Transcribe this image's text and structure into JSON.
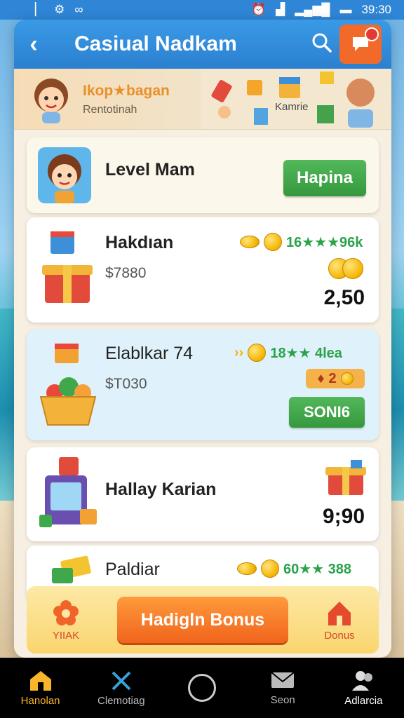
{
  "status_bar": {
    "time": "39:30"
  },
  "topbar": {
    "title": "Casiual Nadkam"
  },
  "banner": {
    "title": "Ikop★bagan",
    "subtitle": "Rentotinah",
    "right_label": "Kamrie"
  },
  "cards": [
    {
      "title": "Level Mam",
      "button": "Hapina"
    },
    {
      "title": "Hakdıan",
      "sub": "$7880",
      "stats": "16★★★96k",
      "value": "2,50"
    },
    {
      "title": "Elablkar 74",
      "sub": "$T030",
      "stats": "18★★ 4lea",
      "mini": "2",
      "button": "SONI6"
    },
    {
      "title": "Hallay Karian",
      "value": "9;90"
    },
    {
      "title": "Paldiar",
      "stats": "60★★ 388"
    }
  ],
  "bonus": {
    "left_label": "YIIAK",
    "button": "Hadigln Bonus",
    "right_label": "Donus"
  },
  "bottom_nav": [
    {
      "label": "Hanolan",
      "icon": "home-icon",
      "active": true
    },
    {
      "label": "Clemotiag",
      "icon": "tools-icon",
      "active": false
    },
    {
      "label": "",
      "icon": "circle-home-button",
      "active": false
    },
    {
      "label": "Seon",
      "icon": "mail-icon",
      "active": false
    },
    {
      "label": "Adlarcia",
      "icon": "people-icon",
      "active": false
    }
  ],
  "colors": {
    "primary_blue": "#2f86d6",
    "accent_orange": "#f0641c",
    "green": "#35983d",
    "card_highlight": "#dff2fb"
  }
}
